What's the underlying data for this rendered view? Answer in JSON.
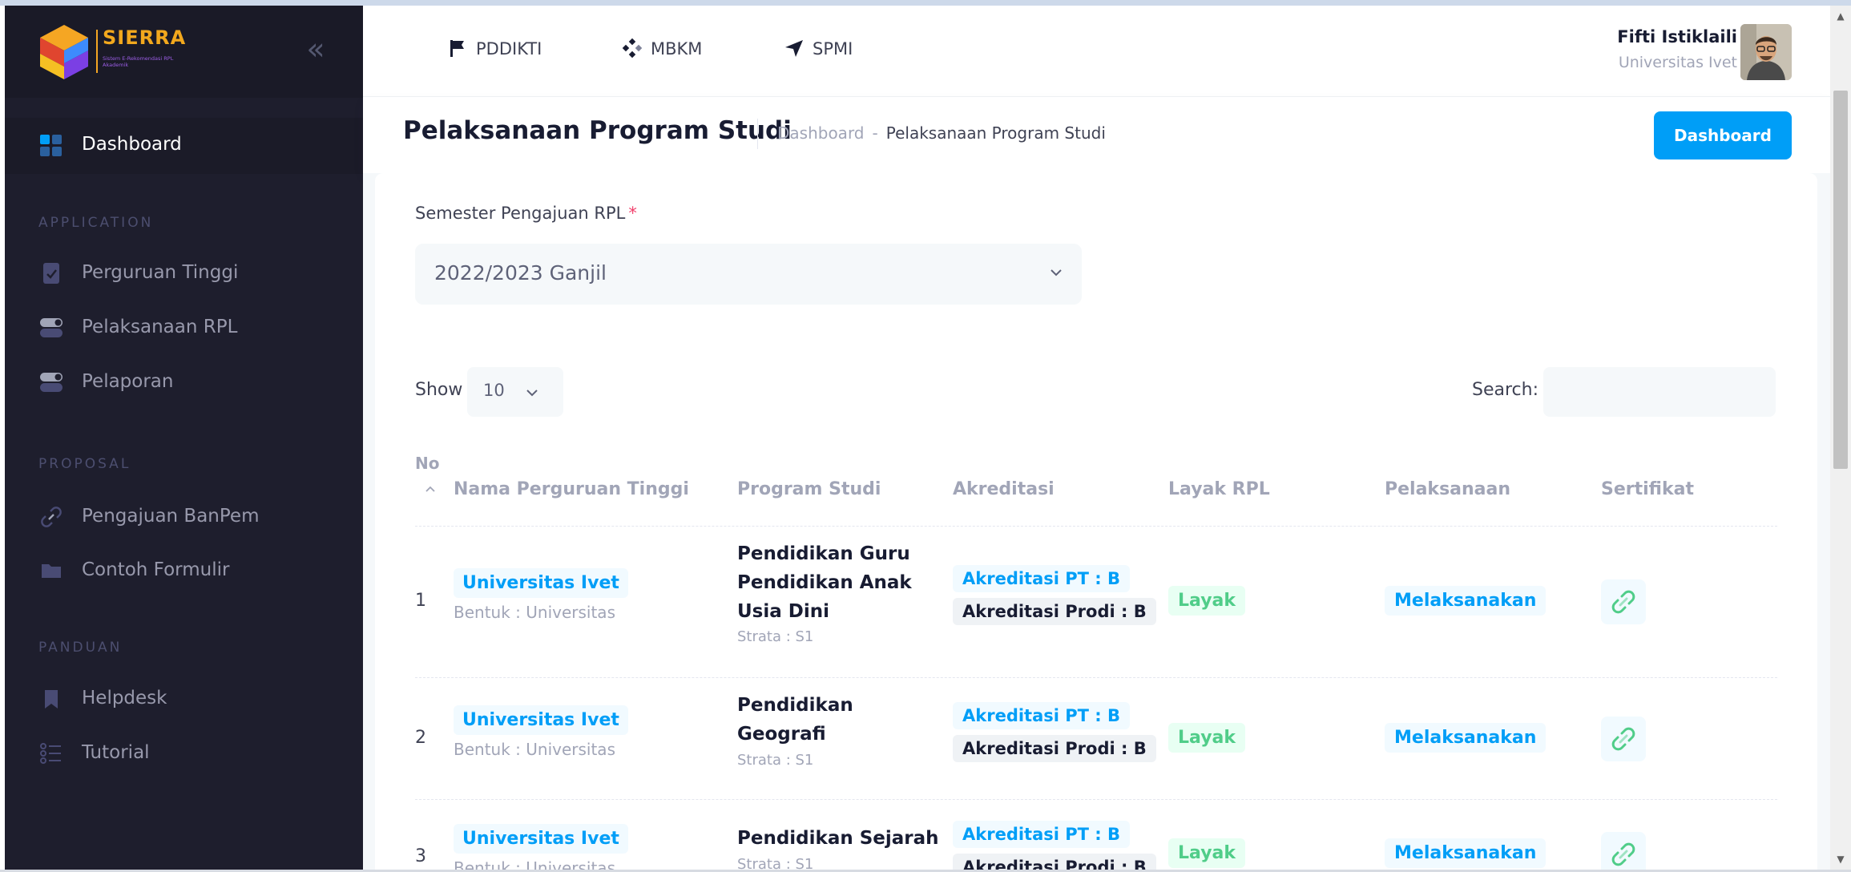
{
  "brand": {
    "title": "SIERRA",
    "subtitle": "Sistem E-Rekomendasi RPL Akademik"
  },
  "sidebar": {
    "dashboard": "Dashboard",
    "sections": {
      "application": "APPLICATION",
      "proposal": "PROPOSAL",
      "panduan": "PANDUAN"
    },
    "items": [
      {
        "label": "Perguruan Tinggi",
        "icon": "document-check-icon"
      },
      {
        "label": "Pelaksanaan RPL",
        "icon": "toggle-icon"
      },
      {
        "label": "Pelaporan",
        "icon": "toggle-icon"
      },
      {
        "label": "Pengajuan BanPem",
        "icon": "link-icon"
      },
      {
        "label": "Contoh Formulir",
        "icon": "folder-icon"
      },
      {
        "label": "Helpdesk",
        "icon": "bookmark-icon"
      },
      {
        "label": "Tutorial",
        "icon": "list-icon"
      }
    ]
  },
  "topnav": {
    "links": [
      {
        "label": "PDDIKTI",
        "icon": "flag-icon"
      },
      {
        "label": "MBKM",
        "icon": "diamond-dots-icon"
      },
      {
        "label": "SPMI",
        "icon": "send-icon"
      }
    ],
    "user_name": "Fifti Istiklaili",
    "user_org": "Universitas Ivet"
  },
  "subheader": {
    "title": "Pelaksanaan Program Studi",
    "breadcrumb": [
      "Dashboard",
      "-",
      "Pelaksanaan Program Studi"
    ],
    "button": "Dashboard"
  },
  "form": {
    "semester_label": "Semester Pengajuan RPL",
    "required_mark": "*",
    "semester_value": "2022/2023 Ganjil"
  },
  "table_controls": {
    "show_label": "Show",
    "show_value": "10",
    "search_label": "Search:",
    "search_value": ""
  },
  "table": {
    "headers": {
      "no": "No",
      "nama": "Nama Perguruan Tinggi",
      "prodi": "Program Studi",
      "akreditasi": "Akreditasi",
      "layak": "Layak RPL",
      "pelaksanaan": "Pelaksanaan",
      "sertifikat": "Sertifikat"
    },
    "rows": [
      {
        "no": "1",
        "univ": "Universitas Ivet",
        "bentuk": "Bentuk : Universitas",
        "prodi": "Pendidikan Guru Pendidikan Anak Usia Dini",
        "strata": "Strata : S1",
        "akred_pt": "Akreditasi PT : B",
        "akred_prodi": "Akreditasi Prodi : B",
        "layak": "Layak",
        "pelaksanaan": "Melaksanakan"
      },
      {
        "no": "2",
        "univ": "Universitas Ivet",
        "bentuk": "Bentuk : Universitas",
        "prodi": "Pendidikan Geografi",
        "strata": "Strata : S1",
        "akred_pt": "Akreditasi PT : B",
        "akred_prodi": "Akreditasi Prodi : B",
        "layak": "Layak",
        "pelaksanaan": "Melaksanakan"
      },
      {
        "no": "3",
        "univ": "Universitas Ivet",
        "bentuk": "Bentuk : Universitas",
        "prodi": "Pendidikan Sejarah",
        "strata": "Strata : S1",
        "akred_pt": "Akreditasi PT : B",
        "akred_prodi": "Akreditasi Prodi : B",
        "layak": "Layak",
        "pelaksanaan": "Melaksanakan"
      }
    ]
  },
  "colors": {
    "primary": "#009ef7",
    "success": "#50cd89",
    "sidebar_bg": "#1e1e2d",
    "brand_orange": "#f2a81d",
    "danger": "#f1416c"
  }
}
